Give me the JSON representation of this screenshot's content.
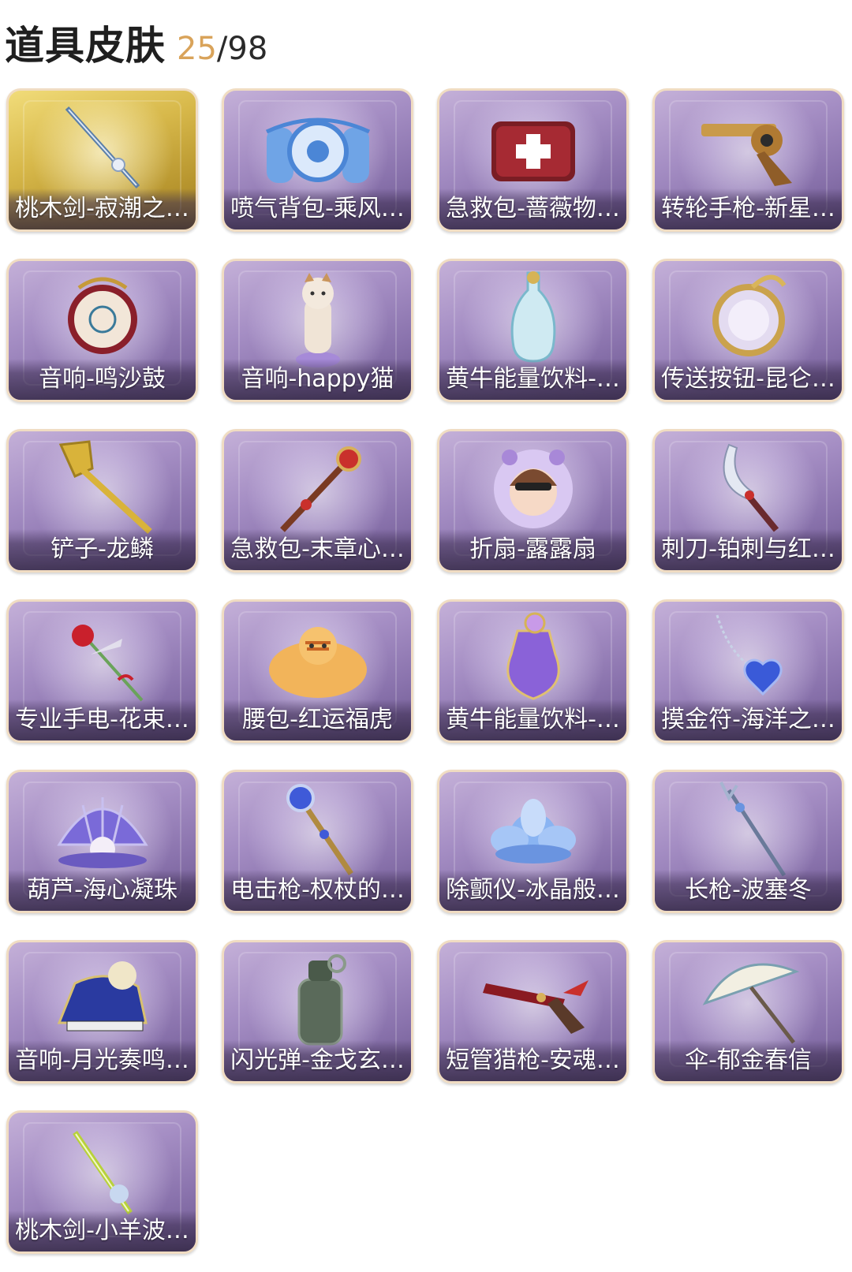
{
  "header": {
    "title": "道具皮肤",
    "owned": "25",
    "total": "/98"
  },
  "items": [
    {
      "label": "桃木剑-寂潮之…",
      "icon": "sword-icon",
      "bg": "gold"
    },
    {
      "label": "喷气背包-乘风…",
      "icon": "jetpack-icon",
      "bg": "purple"
    },
    {
      "label": "急救包-蔷薇物…",
      "icon": "medkit-icon",
      "bg": "purple"
    },
    {
      "label": "转轮手枪-新星…",
      "icon": "revolver-icon",
      "bg": "purple"
    },
    {
      "label": "音响-鸣沙鼓",
      "icon": "drum-icon",
      "bg": "purple"
    },
    {
      "label": "音响-happy猫",
      "icon": "cat-figure-icon",
      "bg": "purple"
    },
    {
      "label": "黄牛能量饮料-…",
      "icon": "bottle-icon",
      "bg": "purple"
    },
    {
      "label": "传送按钮-昆仑…",
      "icon": "ring-icon",
      "bg": "purple"
    },
    {
      "label": "铲子-龙鳞",
      "icon": "shovel-icon",
      "bg": "purple"
    },
    {
      "label": "急救包-末章心…",
      "icon": "scepter-icon",
      "bg": "purple"
    },
    {
      "label": "折扇-露露扇",
      "icon": "fan-character-icon",
      "bg": "purple"
    },
    {
      "label": "刺刀-铂刺与红…",
      "icon": "blade-icon",
      "bg": "purple"
    },
    {
      "label": "专业手电-花束…",
      "icon": "rose-icon",
      "bg": "purple"
    },
    {
      "label": "腰包-红运福虎",
      "icon": "tiger-pouch-icon",
      "bg": "purple"
    },
    {
      "label": "黄牛能量饮料-…",
      "icon": "potion-icon",
      "bg": "purple"
    },
    {
      "label": "摸金符-海洋之…",
      "icon": "heart-pendant-icon",
      "bg": "purple"
    },
    {
      "label": "葫芦-海心凝珠",
      "icon": "shell-icon",
      "bg": "purple"
    },
    {
      "label": "电击枪-权杖的…",
      "icon": "staff-icon",
      "bg": "purple"
    },
    {
      "label": "除颤仪-冰晶般…",
      "icon": "lotus-icon",
      "bg": "purple"
    },
    {
      "label": "长枪-波塞冬",
      "icon": "trident-icon",
      "bg": "purple"
    },
    {
      "label": "音响-月光奏鸣…",
      "icon": "piano-icon",
      "bg": "purple"
    },
    {
      "label": "闪光弹-金戈玄…",
      "icon": "grenade-icon",
      "bg": "purple"
    },
    {
      "label": "短管猎枪-安魂…",
      "icon": "shotgun-icon",
      "bg": "purple"
    },
    {
      "label": "伞-郁金春信",
      "icon": "umbrella-icon",
      "bg": "purple"
    },
    {
      "label": "桃木剑-小羊波…",
      "icon": "green-sword-icon",
      "bg": "purple"
    }
  ]
}
